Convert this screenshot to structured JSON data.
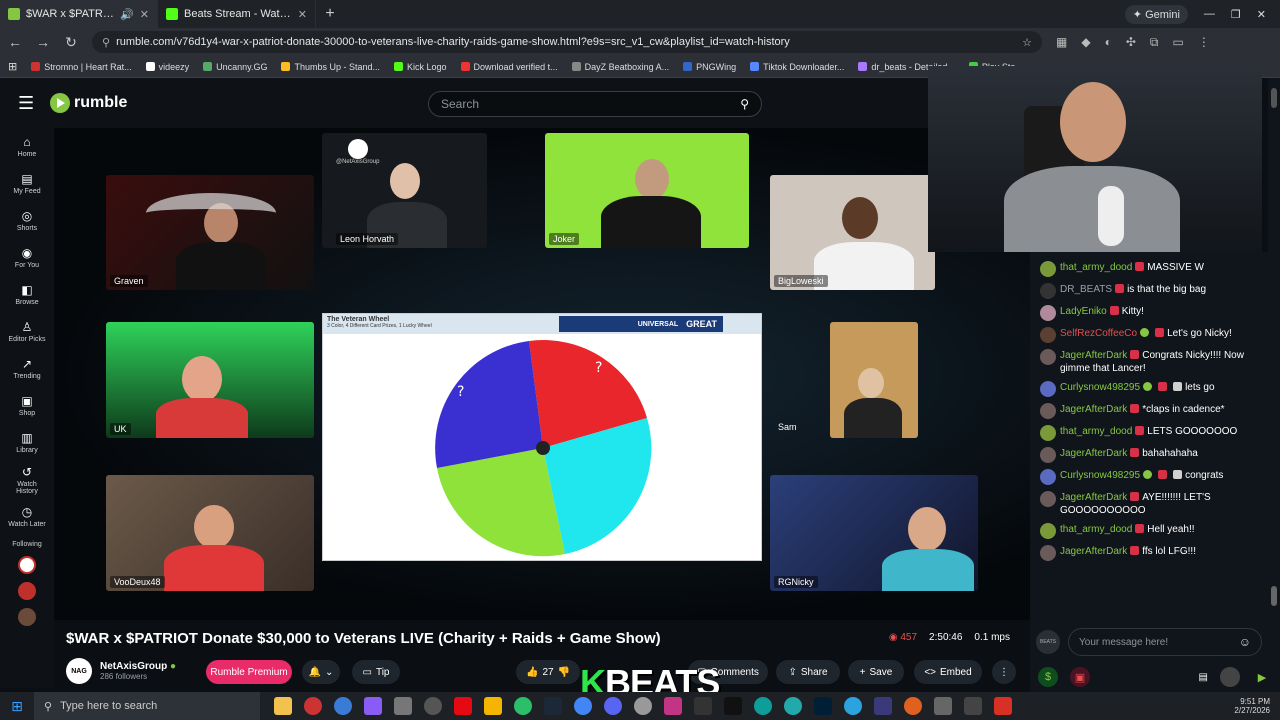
{
  "browser": {
    "tabs": [
      {
        "label": "$WAR x $PATRIOT Donate $",
        "active": true
      },
      {
        "label": "Beats Stream - Watch Live on K",
        "active": false
      }
    ],
    "new_tab": "+",
    "gemini": "Gemini",
    "url": "rumble.com/v76d1y4-war-x-patriot-donate-30000-to-veterans-live-charity-raids-game-show.html?e9s=src_v1_cw&playlist_id=watch-history",
    "bookmarks": [
      "Stromno | Heart Rat...",
      "videezy",
      "Uncanny.GG",
      "Thumbs Up - Stand...",
      "Kick Logo",
      "Download verified t...",
      "DayZ Beatboxing A...",
      "PNGWing",
      "Tiktok Downloader...",
      "dr_beats - Detailed...",
      "Play Sto"
    ]
  },
  "rumble": {
    "brand": "rumble",
    "search_placeholder": "Search",
    "nav": [
      {
        "label": "Home",
        "icon": "⌂"
      },
      {
        "label": "My Feed",
        "icon": "▤"
      },
      {
        "label": "Shorts",
        "icon": "◎"
      },
      {
        "label": "For You",
        "icon": "◉"
      },
      {
        "label": "Browse",
        "icon": "◧"
      },
      {
        "label": "Editor Picks",
        "icon": "♙"
      },
      {
        "label": "Trending",
        "icon": "↗"
      },
      {
        "label": "Shop",
        "icon": "▣"
      },
      {
        "label": "Library",
        "icon": "▥"
      },
      {
        "label": "Watch History",
        "icon": "↺"
      },
      {
        "label": "Watch Later",
        "icon": "◷"
      }
    ],
    "following_label": "Following"
  },
  "stage": {
    "cams": [
      {
        "name": "Graven"
      },
      {
        "name": "Leon Horvath"
      },
      {
        "name": "Joker"
      },
      {
        "name": "BigLoweski"
      },
      {
        "name": "UK"
      },
      {
        "name": "Sam"
      },
      {
        "name": "VooDeux48"
      },
      {
        "name": "RGNicky"
      }
    ],
    "netaxis_label": "@NetAxisGroup",
    "wheel_title": "The Veteran Wheel",
    "wheel_sub": "3 Color, 4 Different Card Prizes, 1 Lucky Wheel",
    "ad_text_1": "UNIVERSAL",
    "ad_text_2": "GREAT",
    "wheel_colors": [
      "#e8262b",
      "#20e6ee",
      "#8ee23a",
      "#3a2fd0"
    ]
  },
  "chat": {
    "messages": [
      {
        "user": "that_army_dood",
        "text": "MASSIVE W",
        "color": "g"
      },
      {
        "user": "DR_BEATS",
        "text": "is that the big bag",
        "color": "gr"
      },
      {
        "user": "LadyEniko",
        "text": "Kitty!",
        "color": "g"
      },
      {
        "user": "SelfRezCoffeeCo",
        "text": "Let's go Nicky!",
        "color": "r"
      },
      {
        "user": "JagerAfterDark",
        "text": "Congrats Nicky!!!! Now gimme that Lancer!",
        "color": "g"
      },
      {
        "user": "Curlysnow498295",
        "text": "lets go",
        "color": "g"
      },
      {
        "user": "JagerAfterDark",
        "text": "*claps in cadence*",
        "color": "g"
      },
      {
        "user": "that_army_dood",
        "text": "LETS GOOOOOOO",
        "color": "g"
      },
      {
        "user": "JagerAfterDark",
        "text": "bahahahaha",
        "color": "g"
      },
      {
        "user": "Curlysnow498295",
        "text": "congrats",
        "color": "g"
      },
      {
        "user": "JagerAfterDark",
        "text": "AYE!!!!!!! LET'S GOOOOOOOOOO",
        "color": "g"
      },
      {
        "user": "that_army_dood",
        "text": "Hell yeah!!",
        "color": "g"
      },
      {
        "user": "JagerAfterDark",
        "text": "ffs lol LFG!!!",
        "color": "g"
      }
    ],
    "input_placeholder": "Your message here!",
    "beats_avatar": "BEATS"
  },
  "video": {
    "title": "$WAR x $PATRIOT Donate $30,000 to Veterans LIVE (Charity + Raids + Game Show)",
    "viewers": "457",
    "duration": "2:50:46",
    "bitrate": "0.1 mps",
    "channel": "NetAxisGroup",
    "followers": "286 followers",
    "premium": "Rumble Premium",
    "tip": "Tip",
    "likes": "27",
    "comments": "Comments",
    "share": "Share",
    "save": "Save",
    "embed": "Embed"
  },
  "overlay": {
    "k": "K",
    "beats": "BEATS"
  },
  "taskbar": {
    "search_placeholder": "Type here to search",
    "time": "9:51 PM",
    "date": "2/27/2026"
  }
}
